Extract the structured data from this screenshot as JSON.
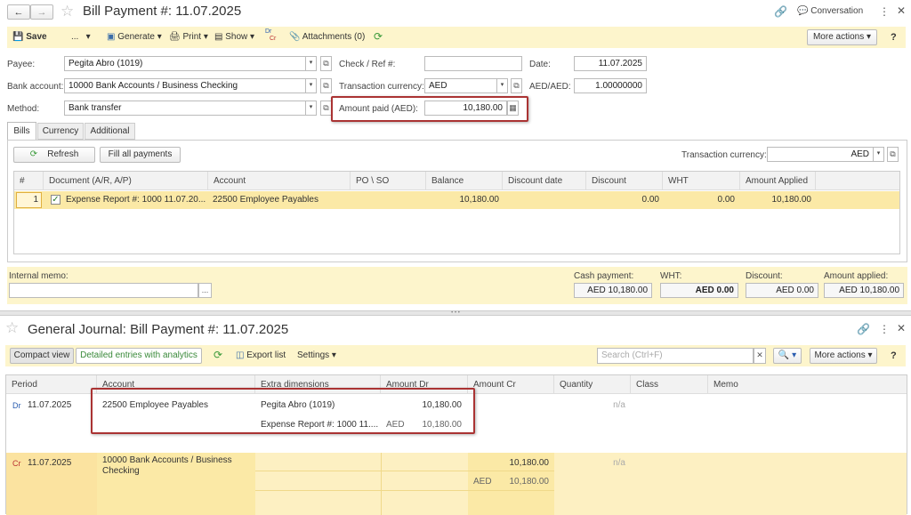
{
  "bill": {
    "title": "Bill Payment #:  11.07.2025",
    "conversation": "Conversation",
    "toolbar": {
      "save": "Save",
      "more_dots": "...",
      "generate": "Generate",
      "print": "Print",
      "show": "Show",
      "dr": "Dr",
      "cr": "Cr",
      "attachments": "Attachments (0)",
      "more_actions": "More actions",
      "help": "?"
    },
    "form": {
      "payee_label": "Payee:",
      "payee_value": "Pegita Abro (1019)",
      "bank_label": "Bank account:",
      "bank_value": "10000 Bank Accounts / Business Checking",
      "method_label": "Method:",
      "method_value": "Bank transfer",
      "check_label": "Check / Ref #:",
      "check_value": "",
      "currency_label": "Transaction currency:",
      "currency_value": "AED",
      "amount_label": "Amount paid (AED):",
      "amount_value": "10,180.00",
      "date_label": "Date:",
      "date_value": "11.07.2025",
      "rate_label": "AED/AED:",
      "rate_value": "1.00000000"
    },
    "tabs": [
      "Bills",
      "Currency",
      "Additional"
    ],
    "bills_toolbar": {
      "refresh": "Refresh",
      "fill_all": "Fill all payments",
      "tx_currency_label": "Transaction currency:",
      "tx_currency_value": "AED"
    },
    "table": {
      "headers": [
        "#",
        "Document (A/R, A/P)",
        "Account",
        "PO \\ SO",
        "Balance",
        "Discount date",
        "Discount",
        "WHT",
        "Amount Applied"
      ],
      "row": {
        "num": "1",
        "document": "Expense Report #: 1000 11.07.20...",
        "account": "22500 Employee Payables",
        "po": "",
        "balance": "10,180.00",
        "discount_date": "",
        "discount": "0.00",
        "wht": "0.00",
        "amount_applied": "10,180.00"
      }
    },
    "footer": {
      "memo_label": "Internal memo:",
      "cash_label": "Cash payment:",
      "cash_value": "AED 10,180.00",
      "wht_label": "WHT:",
      "wht_value": "AED 0.00",
      "discount_label": "Discount:",
      "discount_value": "AED 0.00",
      "applied_label": "Amount applied:",
      "applied_value": "AED 10,180.00"
    }
  },
  "journal": {
    "title": "General Journal: Bill Payment #:  11.07.2025",
    "toolbar": {
      "compact": "Compact view",
      "detailed": "Detailed entries with analytics",
      "export": "Export list",
      "settings": "Settings",
      "search_placeholder": "Search (Ctrl+F)",
      "more_actions": "More actions",
      "help": "?"
    },
    "headers": [
      "Period",
      "Account",
      "Extra dimensions",
      "Amount Dr",
      "Amount Cr",
      "Quantity",
      "Class",
      "Memo"
    ],
    "dr_row": {
      "type": "Dr",
      "period": "11.07.2025",
      "account": "22500 Employee Payables",
      "dim1": "Pegita Abro (1019)",
      "dim2": "Expense Report #: 1000 11....",
      "amount": "10,180.00",
      "currency": "AED",
      "currency_amount": "10,180.00",
      "quantity": "n/a"
    },
    "cr_row": {
      "type": "Cr",
      "period": "11.07.2025",
      "account_line1": "10000 Bank Accounts / Business",
      "account_line2": "Checking",
      "amount": "10,180.00",
      "currency": "AED",
      "currency_amount": "10,180.00",
      "quantity": "n/a"
    }
  },
  "colors": {
    "toolbar_bg": "#fdf5cc",
    "row_highlight": "#fbe9a6",
    "cr_row": "#fdf0c2",
    "accent_green": "#3a9a3a",
    "red_box": "#a33333",
    "link_blue": "#2a5db0"
  }
}
